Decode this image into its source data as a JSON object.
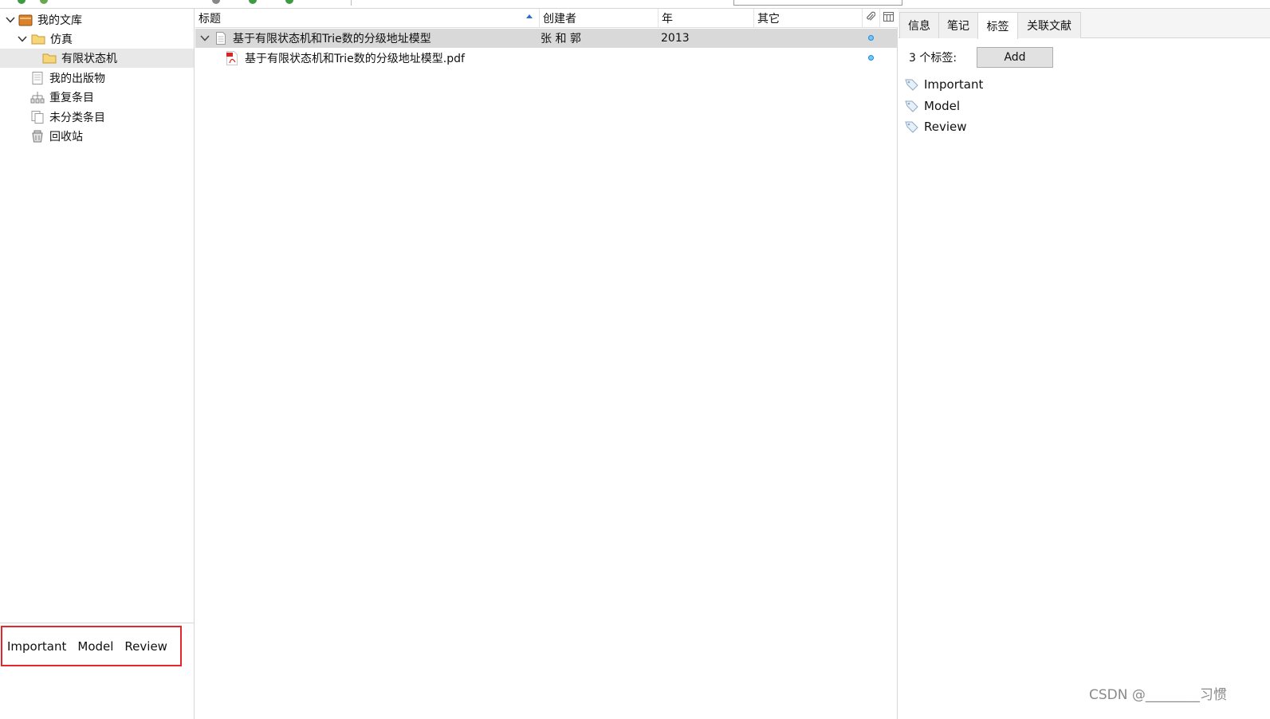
{
  "tree": {
    "library": "我的文库",
    "collection": "仿真",
    "subcollection": "有限状态机",
    "my_publications": "我的出版物",
    "duplicates": "重复条目",
    "unfiled": "未分类条目",
    "trash": "回收站"
  },
  "tag_selector": {
    "tags": [
      "Important",
      "Model",
      "Review"
    ]
  },
  "columns": {
    "title": "标题",
    "creator": "创建者",
    "year": "年",
    "extra": "其它"
  },
  "items": [
    {
      "title": "基于有限状态机和Trie数的分级地址模型",
      "creator": "张 和 郭",
      "year": "2013"
    },
    {
      "title": "基于有限状态机和Trie数的分级地址模型.pdf",
      "creator": "",
      "year": ""
    }
  ],
  "right_tabs": [
    "信息",
    "笔记",
    "标签",
    "关联文献"
  ],
  "tags_panel": {
    "count_label": "3 个标签:",
    "add_label": "Add",
    "tags": [
      "Important",
      "Model",
      "Review"
    ]
  },
  "watermark": "CSDN @________习惯",
  "colors": {
    "selected_row": "#d9d9d9",
    "selected_tree": "#e8e8e8",
    "highlight_box": "#e5262b",
    "sort_arrow": "#2e6dd6",
    "unread_dot": "#1a8be0"
  }
}
